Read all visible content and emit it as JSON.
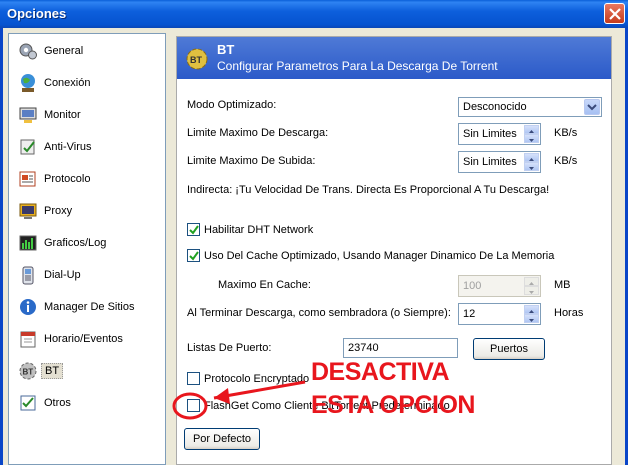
{
  "window": {
    "title": "Opciones"
  },
  "nav": {
    "items": [
      {
        "label": "General",
        "icon": "gears-icon"
      },
      {
        "label": "Conexión",
        "icon": "globe-icon"
      },
      {
        "label": "Monitor",
        "icon": "monitor-icon"
      },
      {
        "label": "Anti-Virus",
        "icon": "antivirus-icon"
      },
      {
        "label": "Protocolo",
        "icon": "protocol-icon"
      },
      {
        "label": "Proxy",
        "icon": "proxy-icon"
      },
      {
        "label": "Graficos/Log",
        "icon": "chart-icon"
      },
      {
        "label": "Dial-Up",
        "icon": "phone-icon"
      },
      {
        "label": "Manager De Sitios",
        "icon": "info-icon"
      },
      {
        "label": "Horario/Eventos",
        "icon": "calendar-icon"
      },
      {
        "label": "BT",
        "icon": "bt-gear-icon"
      },
      {
        "label": "Otros",
        "icon": "checklist-icon"
      }
    ],
    "selected": "BT"
  },
  "header": {
    "title": "BT",
    "subtitle": "Configurar Parametros Para La Descarga De Torrent"
  },
  "form": {
    "mode_label": "Modo Optimizado:",
    "mode_value": "Desconocido",
    "download_label": "Limite Maximo De Descarga:",
    "download_value": "Sin Limites",
    "download_unit": "KB/s",
    "upload_label": "Limite Maximo De Subida:",
    "upload_value": "Sin Limites",
    "upload_unit": "KB/s",
    "indirect_note": "Indirecta: ¡Tu Velocidad De Trans. Directa Es Proporcional A Tu Descarga!",
    "dht_label": "Habilitar DHT Network",
    "dht_checked": true,
    "cache_label": "Uso Del Cache Optimizado, Usando Manager Dinamico De La Memoria",
    "cache_checked": true,
    "max_cache_label": "Maximo En Cache:",
    "max_cache_value": "100",
    "max_cache_unit": "MB",
    "seed_label": "Al Terminar Descarga, como sembradora (o Siempre):",
    "seed_value": "12",
    "seed_unit": "Horas",
    "ports_label": "Listas De Puerto:",
    "ports_value": "23740",
    "ports_button": "Puertos",
    "encrypted_label": "Protocolo Encryptado",
    "encrypted_checked": false,
    "default_client_label": "FlashGet Como Cliente BitTorrent Predeterminado",
    "default_client_checked": false,
    "defaults_button": "Por Defecto"
  },
  "annotation": {
    "line1": "DESACTIVA",
    "line2": "ESTA OPCION",
    "color": "#e8161d"
  }
}
